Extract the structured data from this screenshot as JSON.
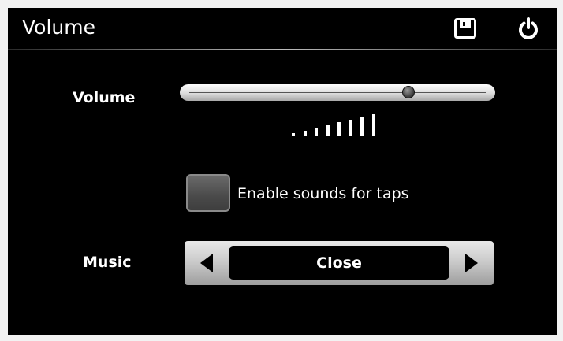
{
  "header": {
    "title": "Volume",
    "save_icon": "save-icon",
    "power_icon": "power-icon"
  },
  "volume": {
    "label": "Volume",
    "level_fraction": 0.74,
    "indicator_bars": 8
  },
  "tap_sounds": {
    "label": "Enable sounds for taps",
    "checked": false
  },
  "music": {
    "label": "Music",
    "value": "Close",
    "prev_icon": "triangle-left-icon",
    "next_icon": "triangle-right-icon"
  },
  "colors": {
    "background": "#000000",
    "text": "#ffffff",
    "control_silver": "#c8c8c8",
    "checkbox_gray": "#555555"
  }
}
